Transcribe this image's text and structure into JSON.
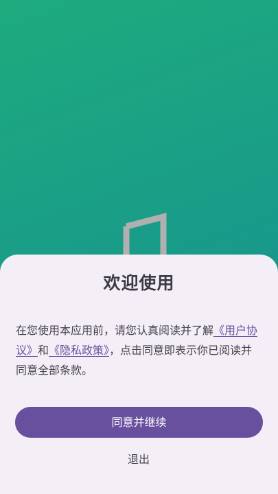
{
  "dialog": {
    "title": "欢迎使用",
    "text_before": "在您使用本应用前，请您认真阅读并了解",
    "user_agreement_link": "《用户协议》",
    "text_and": "和",
    "privacy_policy_link": "《隐私政策》",
    "text_after": "，点击同意即表示你已阅读并同意全部条款。",
    "agree_button": "同意并继续",
    "exit_button": "退出"
  },
  "colors": {
    "background_gradient_start": "#1eab7e",
    "background_gradient_end": "#158b95",
    "sheet_background": "#f4eff7",
    "primary": "#68509f",
    "link": "#6650a0",
    "logo": "#b0b0b0"
  },
  "icons": {
    "app_logo": "door-logo-icon"
  }
}
